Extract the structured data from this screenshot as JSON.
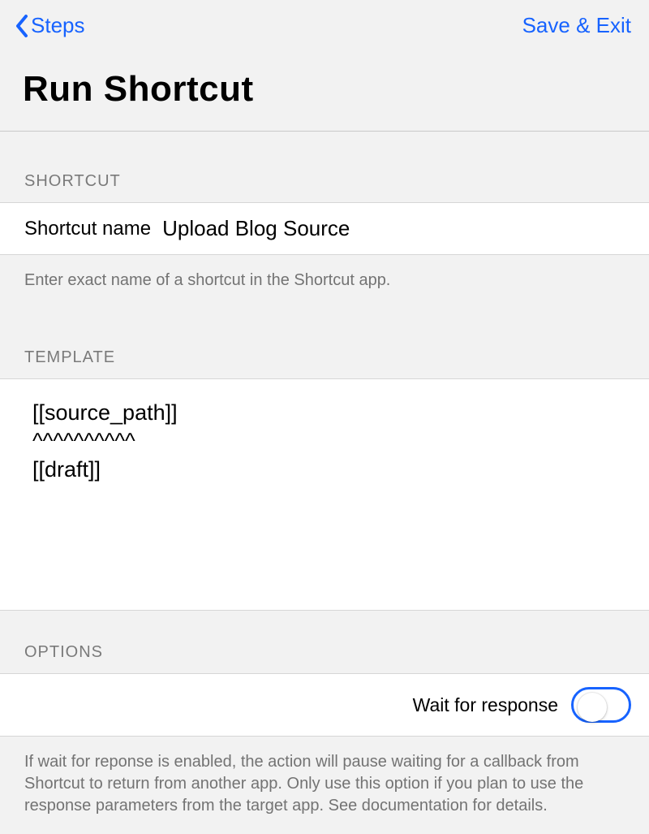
{
  "nav": {
    "back_label": "Steps",
    "save_label": "Save & Exit"
  },
  "page": {
    "title": "Run Shortcut"
  },
  "sections": {
    "shortcut": {
      "header": "SHORTCUT",
      "field_label": "Shortcut name",
      "field_value": "Upload Blog Source",
      "footnote": "Enter exact name of a shortcut in the Shortcut app."
    },
    "template": {
      "header": "TEMPLATE",
      "content": "[[source_path]]\n^^^^^^^^^^\n[[draft]]"
    },
    "options": {
      "header": "OPTIONS",
      "wait_label": "Wait for response",
      "wait_value": false,
      "footnote": "If wait for reponse is enabled, the action will pause waiting for a callback from Shortcut to return from another app. Only use this option if you plan to use the response parameters from the target app. See documentation for details."
    }
  },
  "colors": {
    "accent": "#1763ff",
    "bg": "#f2f2f2",
    "muted": "#7a7a7a"
  }
}
